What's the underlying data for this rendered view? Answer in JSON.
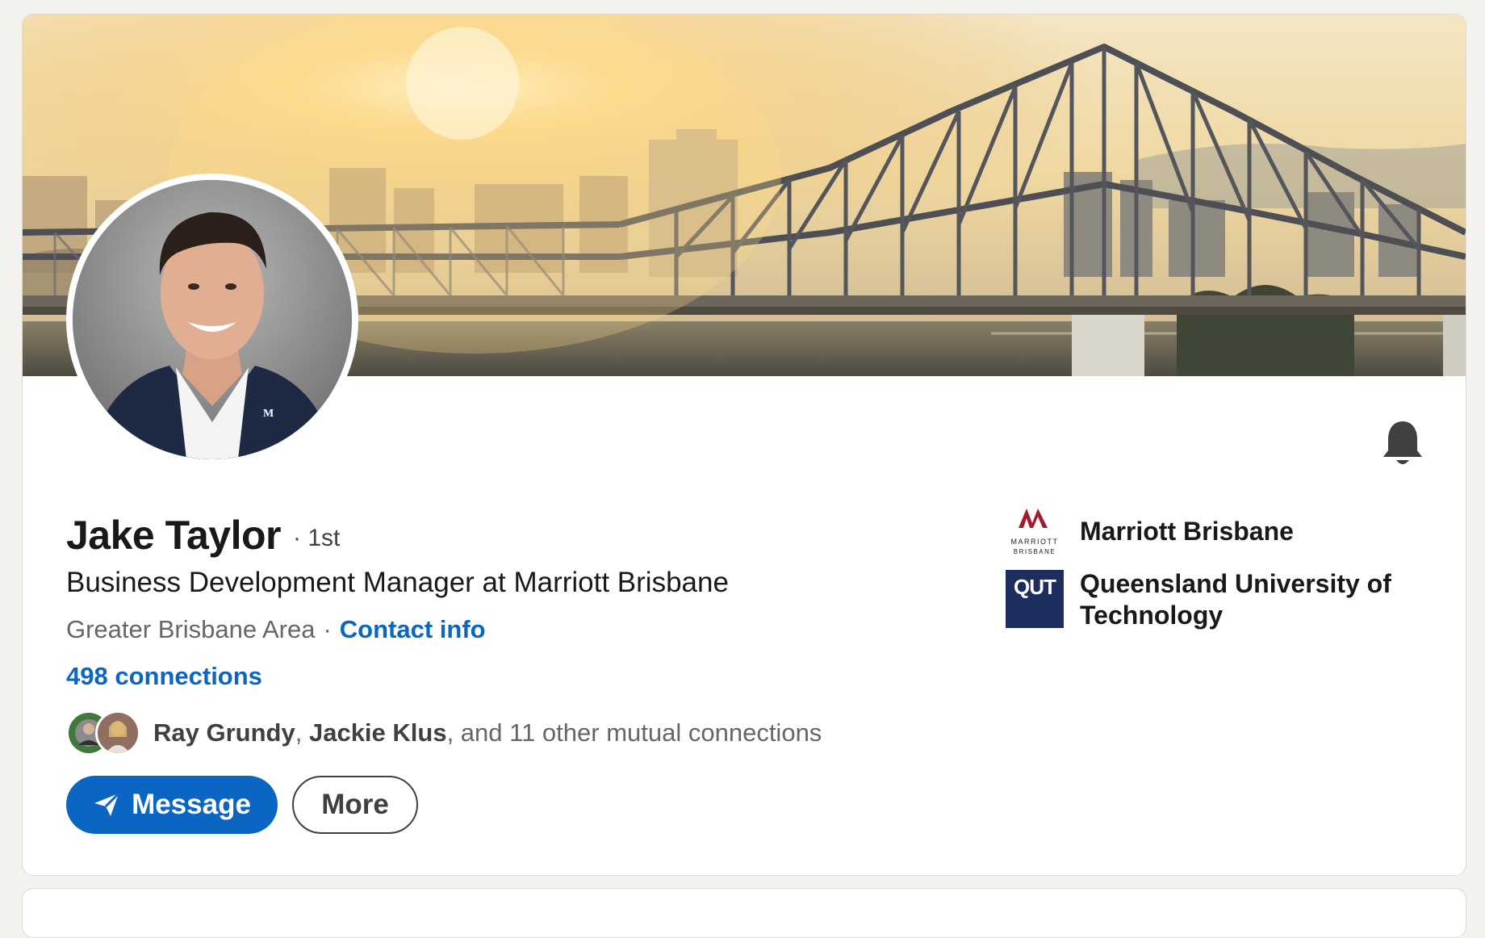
{
  "profile": {
    "name": "Jake Taylor",
    "degree": "· 1st",
    "headline": "Business Development Manager at Marriott Brisbane",
    "location": "Greater Brisbane Area",
    "location_separator": "·",
    "contact_info_label": "Contact info",
    "connections_label": "498 connections"
  },
  "mutual": {
    "name_1": "Ray Grundy",
    "separator": ",",
    "name_2": "Jackie Klus",
    "rest": ", and 11 other mutual connections"
  },
  "actions": {
    "message_label": "Message",
    "more_label": "More"
  },
  "organizations": [
    {
      "name": "Marriott Brisbane",
      "logo_text_1": "MARRIOTT",
      "logo_text_2": "BRISBANE",
      "icon": "marriott-logo"
    },
    {
      "name": "Queensland University of Technology",
      "logo_text": "QUT",
      "icon": "qut-logo"
    }
  ],
  "colors": {
    "link": "#0a66c2",
    "primary_button": "#0a66c2",
    "qut_navy": "#1d2e5e",
    "marriott_red": "#a6192e"
  },
  "icons": {
    "notify": "bell-icon",
    "message": "paper-plane-icon"
  }
}
